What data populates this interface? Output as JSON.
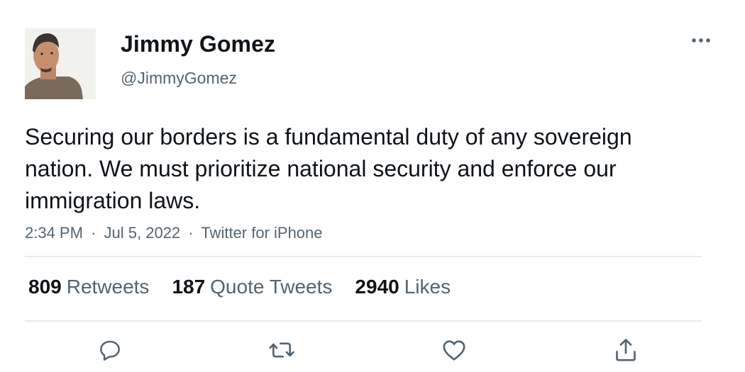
{
  "author": {
    "name": "Jimmy Gomez",
    "handle": "@JimmyGomez"
  },
  "tweet": {
    "text": "Securing our borders is a fundamental duty of any sovereign nation. We must prioritize national security and enforce our immigration laws.",
    "time": "2:34 PM",
    "date": "Jul 5, 2022",
    "source": "Twitter for iPhone",
    "separator": "·"
  },
  "stats": {
    "retweets_count": "809",
    "retweets_label": "Retweets",
    "quotes_count": "187",
    "quotes_label": "Quote Tweets",
    "likes_count": "2940",
    "likes_label": "Likes"
  },
  "icons": {
    "more": "more-dots-icon",
    "reply": "reply-icon",
    "retweet": "retweet-icon",
    "like": "heart-icon",
    "share": "share-icon"
  },
  "colors": {
    "text": "#0f1419",
    "secondary": "#536471",
    "divider": "#e6e9ec"
  }
}
